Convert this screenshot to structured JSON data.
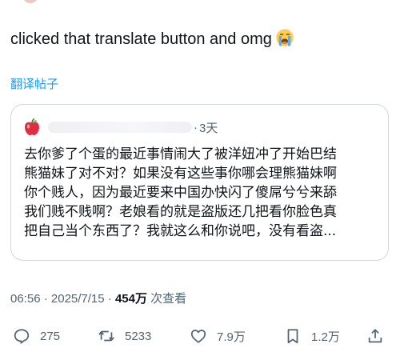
{
  "post": {
    "text": "clicked that translate button and omg",
    "emoji": "loudly-crying-face-emoji",
    "translate_link": "翻译帖子"
  },
  "quote": {
    "avatar_icon": "red-apple-icon",
    "time": "3天",
    "separator": "·",
    "lines": [
      "去你爹了个蛋的最近事情闹大了被洋妞冲了开始巴结",
      "熊猫妹了对不对？如果没有这些事你哪会理熊猫妹啊",
      "你个贱人，因为最近要来中国办快闪了傻屌兮兮来舔",
      "我们贱不贱啊？老娘看的就是盗版还几把看你脸色真",
      "把自己当个东西了？我就这么和你说吧，没有看盗..."
    ]
  },
  "meta": {
    "time": "06:56",
    "sep1": " · ",
    "date": "2025/7/15",
    "sep2": " · ",
    "views": "454万",
    "views_label": " 次查看"
  },
  "actions": {
    "reply_count": "275",
    "repost_count": "5233",
    "like_count": "7.9万",
    "bookmark_count": "1.2万"
  },
  "colors": {
    "accent": "#1d9bf0",
    "secondary_text": "#536471",
    "border": "#cfd9de"
  }
}
